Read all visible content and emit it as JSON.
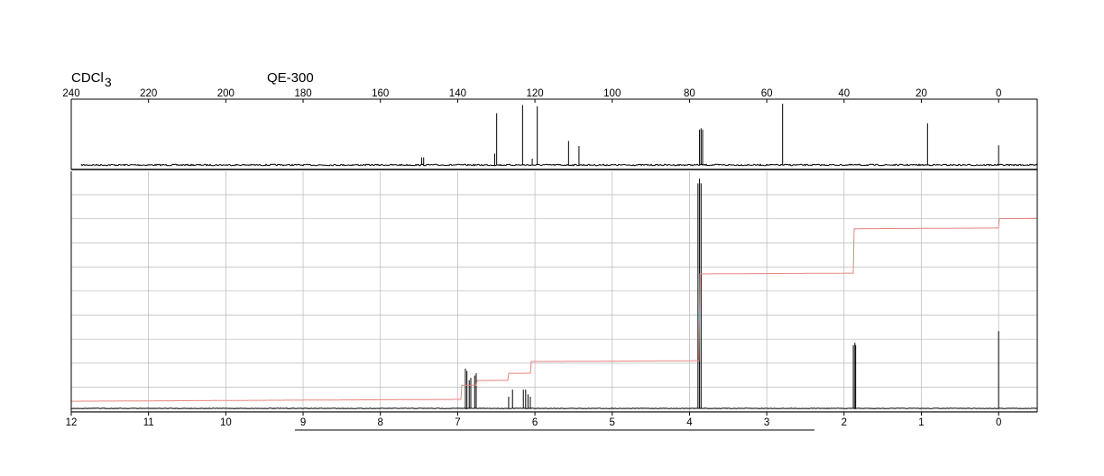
{
  "header": {
    "solvent_main": "CDCl",
    "solvent_sub": "3",
    "instrument": "QE-300"
  },
  "chart_data": [
    {
      "type": "line",
      "title": "",
      "xlabel": "",
      "ylabel": "",
      "x_unit": "ppm",
      "xlim": [
        240,
        -10
      ],
      "reversed_x": true,
      "tick_labels": [
        "240",
        "220",
        "200",
        "180",
        "160",
        "140",
        "120",
        "100",
        "80",
        "60",
        "40",
        "20",
        "0"
      ],
      "tick_values": [
        240,
        220,
        200,
        180,
        160,
        140,
        120,
        100,
        80,
        60,
        40,
        20,
        0
      ],
      "peaks": [
        {
          "ppm": 149.3,
          "height": 0.12
        },
        {
          "ppm": 148.8,
          "height": 0.12
        },
        {
          "ppm": 130.4,
          "height": 0.18
        },
        {
          "ppm": 129.9,
          "height": 0.82
        },
        {
          "ppm": 123.2,
          "height": 0.95
        },
        {
          "ppm": 120.7,
          "height": 0.1
        },
        {
          "ppm": 119.4,
          "height": 0.93
        },
        {
          "ppm": 111.3,
          "height": 0.38
        },
        {
          "ppm": 108.6,
          "height": 0.3
        },
        {
          "ppm": 77.4,
          "height": 0.56
        },
        {
          "ppm": 77.0,
          "height": 0.58
        },
        {
          "ppm": 76.6,
          "height": 0.56
        },
        {
          "ppm": 55.9,
          "height": 0.97
        },
        {
          "ppm": 18.4,
          "height": 0.66
        },
        {
          "ppm": 0.0,
          "height": 0.31
        }
      ],
      "grid": false
    },
    {
      "type": "line",
      "title": "",
      "xlabel": "",
      "ylabel": "",
      "x_unit": "ppm",
      "xlim": [
        12,
        -0.5
      ],
      "reversed_x": true,
      "tick_labels": [
        "12",
        "11",
        "10",
        "9",
        "8",
        "7",
        "6",
        "5",
        "4",
        "3",
        "2",
        "1",
        "0"
      ],
      "tick_values": [
        12,
        11,
        10,
        9,
        8,
        7,
        6,
        5,
        4,
        3,
        2,
        1,
        0
      ],
      "peaks": [
        {
          "ppm": 6.9,
          "height": 0.17
        },
        {
          "ppm": 6.88,
          "height": 0.16
        },
        {
          "ppm": 6.85,
          "height": 0.12
        },
        {
          "ppm": 6.83,
          "height": 0.13
        },
        {
          "ppm": 6.78,
          "height": 0.14
        },
        {
          "ppm": 6.76,
          "height": 0.15
        },
        {
          "ppm": 6.34,
          "height": 0.05
        },
        {
          "ppm": 6.29,
          "height": 0.08
        },
        {
          "ppm": 6.15,
          "height": 0.08
        },
        {
          "ppm": 6.12,
          "height": 0.08
        },
        {
          "ppm": 6.09,
          "height": 0.06
        },
        {
          "ppm": 6.06,
          "height": 0.05
        },
        {
          "ppm": 3.89,
          "height": 0.96
        },
        {
          "ppm": 3.87,
          "height": 0.98
        },
        {
          "ppm": 3.85,
          "height": 0.96
        },
        {
          "ppm": 1.88,
          "height": 0.27
        },
        {
          "ppm": 1.86,
          "height": 0.28
        },
        {
          "ppm": 1.85,
          "height": 0.27
        },
        {
          "ppm": 0.0,
          "height": 0.33
        }
      ],
      "integral_steps": [
        {
          "ppm": 6.95,
          "rise": 0.06
        },
        {
          "ppm": 6.75,
          "rise": 0.02
        },
        {
          "ppm": 6.35,
          "rise": 0.03
        },
        {
          "ppm": 6.05,
          "rise": 0.05
        },
        {
          "ppm": 3.87,
          "rise": 0.37
        },
        {
          "ppm": 1.87,
          "rise": 0.19
        },
        {
          "ppm": 0.0,
          "rise": 0.04
        }
      ],
      "grid": true
    }
  ],
  "colors": {
    "spectrum": "#000000",
    "integral": "#e8837e",
    "grid": "#b8b8b8",
    "frame": "#000000"
  }
}
